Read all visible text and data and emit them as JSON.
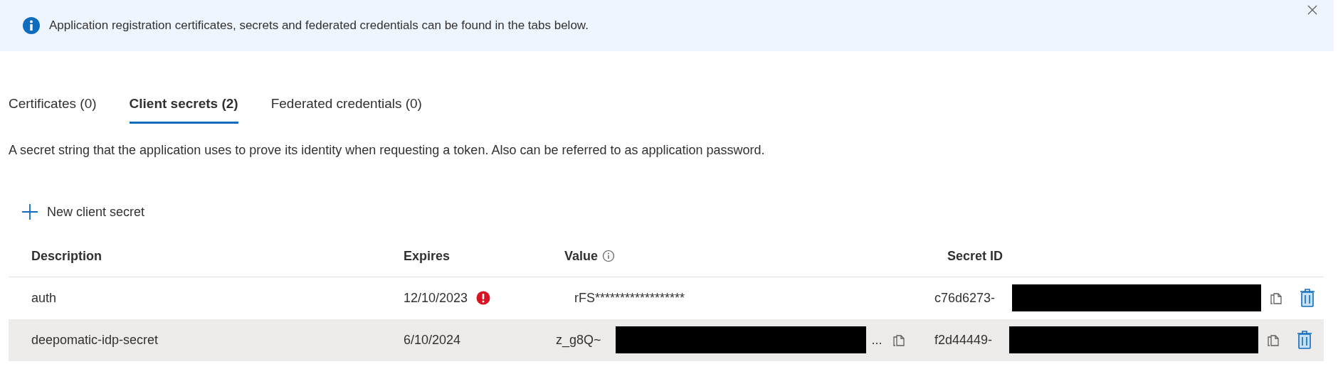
{
  "banner": {
    "message": "Application registration certificates, secrets and federated credentials can be found in the tabs below."
  },
  "tabs": [
    {
      "label": "Certificates (0)",
      "selected": false
    },
    {
      "label": "Client secrets (2)",
      "selected": true
    },
    {
      "label": "Federated credentials (0)",
      "selected": false
    }
  ],
  "description": "A secret string that the application uses to prove its identity when requesting a token. Also can be referred to as application password.",
  "new_button": {
    "label": "New client secret"
  },
  "table": {
    "columns": [
      "Description",
      "Expires",
      "Value",
      "Secret ID"
    ],
    "rows": [
      {
        "description": "auth",
        "expires": "12/10/2023",
        "expired": true,
        "value": "rFS******************",
        "value_redacted": false,
        "value_ellipsis": "",
        "value_copy": false,
        "secret_id": "c76d6273-",
        "secret_id_redacted": true,
        "selected": false
      },
      {
        "description": "deepomatic-idp-secret",
        "expires": "6/10/2024",
        "expired": false,
        "value": "z_g8Q~",
        "value_redacted": true,
        "value_ellipsis": "...",
        "value_copy": true,
        "secret_id": "f2d44449-",
        "secret_id_redacted": true,
        "selected": true
      }
    ]
  }
}
